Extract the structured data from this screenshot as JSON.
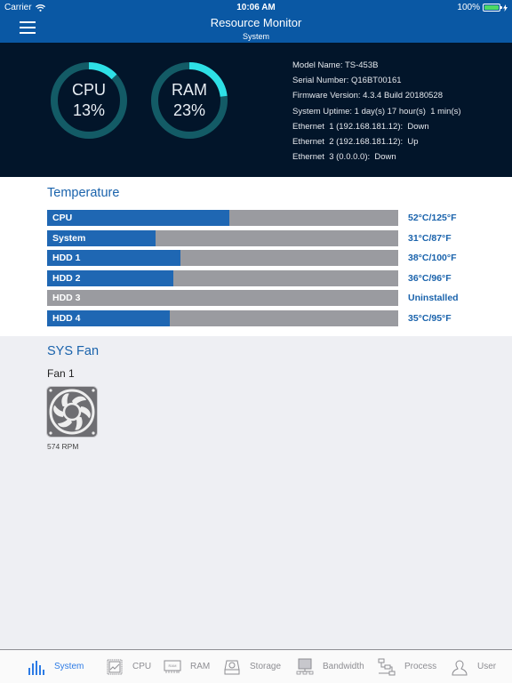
{
  "status_bar": {
    "carrier": "Carrier",
    "time": "10:06 AM",
    "battery": "100%",
    "battery_level": 1.0
  },
  "header": {
    "title": "Resource Monitor",
    "subtitle": "System",
    "menu_icon": "hamburger-menu-icon"
  },
  "gauges": [
    {
      "name": "CPU",
      "value": "13%",
      "fraction": 0.13
    },
    {
      "name": "RAM",
      "value": "23%",
      "fraction": 0.23
    }
  ],
  "system_info": [
    "Model Name: TS-453B",
    "Serial Number: Q16BT00161",
    "Firmware Version: 4.3.4 Build 20180528",
    "System Uptime: 1 day(s) 17 hour(s)  1 min(s)",
    "Ethernet  1 (192.168.181.12):  Down",
    "Ethernet  2 (192.168.181.12):  Up",
    "Ethernet  3 (0.0.0.0):  Down"
  ],
  "temperature": {
    "title": "Temperature",
    "rows": [
      {
        "label": "CPU",
        "value": "52°C/125°F",
        "fraction": 0.52
      },
      {
        "label": "System",
        "value": "31°C/87°F",
        "fraction": 0.31
      },
      {
        "label": "HDD 1",
        "value": "38°C/100°F",
        "fraction": 0.38
      },
      {
        "label": "HDD 2",
        "value": "36°C/96°F",
        "fraction": 0.36
      },
      {
        "label": "HDD 3",
        "value": "Uninstalled",
        "fraction": 0
      },
      {
        "label": "HDD 4",
        "value": "35°C/95°F",
        "fraction": 0.35
      }
    ]
  },
  "fan": {
    "title": "SYS Fan",
    "name": "Fan 1",
    "rpm": "574 RPM",
    "icon": "fan-icon"
  },
  "tabs": [
    {
      "label": "System",
      "icon": "bar-chart-icon",
      "active": true
    },
    {
      "label": "CPU",
      "icon": "cpu-chip-icon",
      "active": false
    },
    {
      "label": "RAM",
      "icon": "ram-module-icon",
      "active": false
    },
    {
      "label": "Storage",
      "icon": "disk-drive-icon",
      "active": false
    },
    {
      "label": "Bandwidth",
      "icon": "network-monitor-icon",
      "active": false
    },
    {
      "label": "Process",
      "icon": "process-flow-icon",
      "active": false
    },
    {
      "label": "User",
      "icon": "user-icon",
      "active": false
    }
  ],
  "colors": {
    "accent": "#0a58a4",
    "bar_fill": "#1f67b3",
    "bar_track": "#9a9ba0",
    "gauge_active": "#2ee0e6",
    "gauge_track": "#135b66",
    "tab_active": "#2d7be5"
  }
}
